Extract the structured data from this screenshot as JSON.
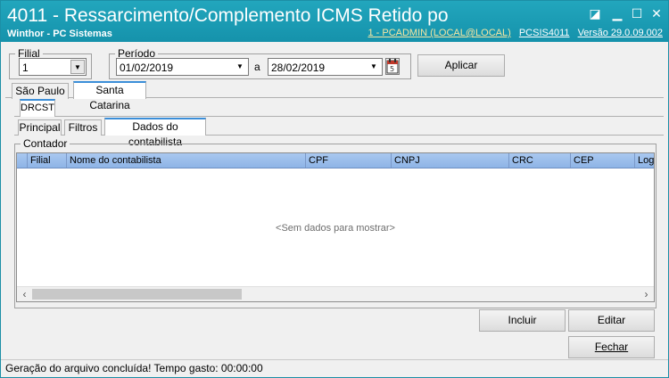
{
  "window": {
    "title": "4011 - Ressarcimento/Complemento ICMS Retido po",
    "subtitle": "Winthor - PC Sistemas",
    "user_info": "1 - PCADMIN (LOCAL@LOCAL)",
    "routine": "PCSIS4011",
    "version": "Versão  29.0.09.002"
  },
  "filial": {
    "legend": "Filial",
    "value": "1"
  },
  "periodo": {
    "legend": "Período",
    "start": "01/02/2019",
    "separator": "a",
    "end": "28/02/2019"
  },
  "buttons": {
    "aplicar": "Aplicar",
    "incluir": "Incluir",
    "editar": "Editar",
    "fechar": "Fechar"
  },
  "tabs_states": [
    "São Paulo",
    "Santa Catarina"
  ],
  "tabs_sub": [
    "DRCST"
  ],
  "tabs_main": [
    "Principal",
    "Filtros",
    "Dados do contabilista"
  ],
  "contador": {
    "legend": "Contador",
    "columns": [
      "Filial",
      "Nome do contabilista",
      "CPF",
      "CNPJ",
      "CRC",
      "CEP",
      "Log"
    ],
    "empty_text": "<Sem dados para mostrar>"
  },
  "status": "Geração do arquivo concluída! Tempo gasto: 00:00:00"
}
